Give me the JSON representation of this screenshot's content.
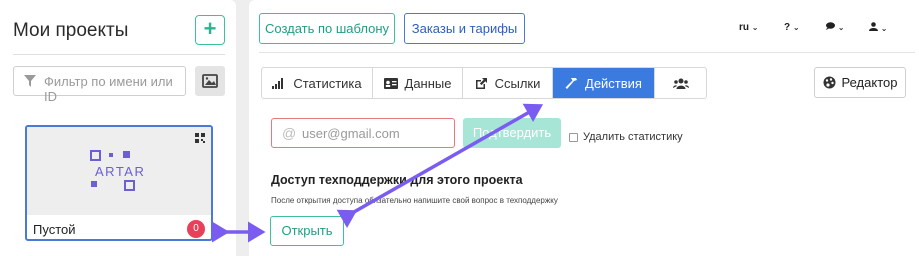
{
  "sidebar": {
    "title": "Мои проекты",
    "add_label": "+",
    "filter_placeholder": "Фильтр по имени или ID",
    "project": {
      "name": "Пустой",
      "badge": "0",
      "logo_text": "ARTAR"
    }
  },
  "toolbar": {
    "create_template": "Создать по шаблону",
    "orders_tariffs": "Заказы и тарифы",
    "lang": "ru",
    "help": "?",
    "chat": "",
    "user": ""
  },
  "tabs": [
    {
      "label": "Статистика",
      "icon": "bar-chart-icon"
    },
    {
      "label": "Данные",
      "icon": "id-card-icon"
    },
    {
      "label": "Ссылки",
      "icon": "external-link-icon"
    },
    {
      "label": "Действия",
      "icon": "hammer-icon",
      "active": true
    },
    {
      "label": "",
      "icon": "users-icon"
    }
  ],
  "editor_label": "Редактор",
  "actions": {
    "email_placeholder": "user@gmail.com",
    "confirm_label": "Подтвердить",
    "delete_stats_label": "Удалить статистику",
    "support_title": "Доступ техподдержки для этого проекта",
    "support_note": "После открытия доступа обязательно напишите свой вопрос в техподдержку",
    "open_label": "Открыть"
  },
  "colors": {
    "accent_green": "#3fbf9f",
    "accent_blue": "#3b7be0",
    "badge_red": "#e83f5b",
    "arrow_purple": "#7b5cf0"
  }
}
